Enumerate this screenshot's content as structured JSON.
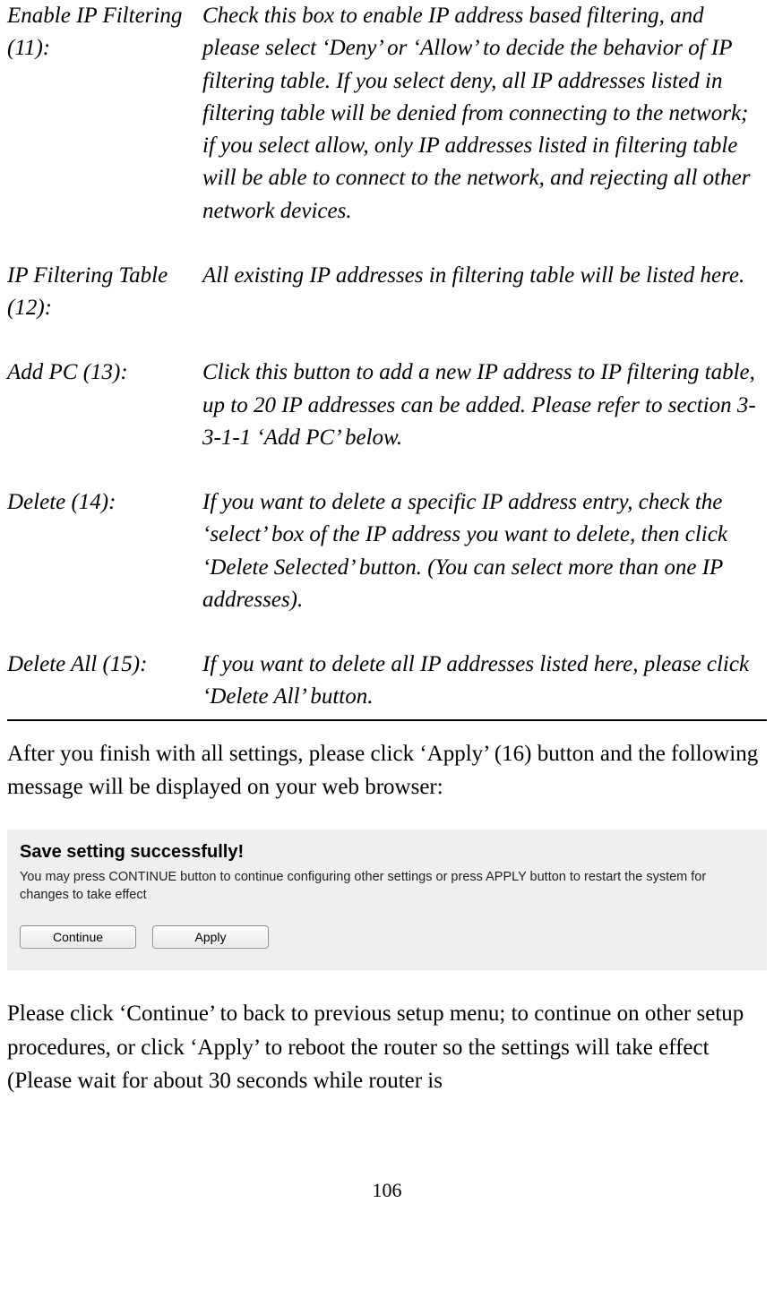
{
  "defs": {
    "enable_ip": {
      "label": "Enable IP Filtering (11):",
      "desc": "Check this box to enable IP address based filtering, and please select ‘Deny’ or ‘Allow’ to decide the behavior of IP filtering table. If you select deny, all IP addresses listed in filtering table will be denied from connecting to the network; if you select allow, only IP addresses listed in filtering table will be able to connect to the network, and rejecting all other network devices."
    },
    "ip_filtering_table": {
      "label": "IP Filtering Table (12):",
      "desc": "All existing IP addresses in filtering table will be listed here."
    },
    "add_pc": {
      "label": "Add PC (13):",
      "desc": "Click this button to add a new IP address to IP filtering table, up to 20 IP addresses can be added. Please refer to section 3-3-1-1 ‘Add PC’ below."
    },
    "delete": {
      "label": "Delete (14):",
      "desc": "If you want to delete a specific IP address entry, check the ‘select’ box of the IP address you want to delete, then click ‘Delete Selected’ button. (You can select more than one IP addresses)."
    },
    "delete_all": {
      "label": "Delete All (15):",
      "desc": "If you want to delete all IP addresses listed here, please click ‘Delete All’ button."
    }
  },
  "para_after_table": "After you finish with all settings, please click ‘Apply’ (16) button and the following message will be displayed on your web browser:",
  "screenshot": {
    "title": "Save setting successfully!",
    "message": "You may press CONTINUE button to continue configuring other settings or press APPLY button to restart the system for changes to take effect",
    "continue_btn": "Continue",
    "apply_btn": "Apply"
  },
  "para_bottom": "Please click ‘Continue’ to back to previous setup menu; to continue on other setup procedures, or click ‘Apply’ to reboot the router so the settings will take effect (Please wait for about 30 seconds while router is",
  "page_number": "106"
}
